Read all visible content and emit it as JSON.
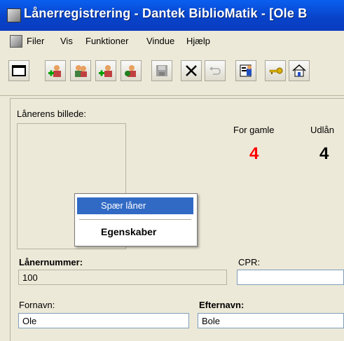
{
  "window": {
    "title": "Lånerregistrering - Dantek BiblioMatik - [Ole B"
  },
  "menu": [
    {
      "label": "Filer"
    },
    {
      "label": "Vis"
    },
    {
      "label": "Funktioner"
    },
    {
      "label": "Vindue"
    },
    {
      "label": "Hjælp"
    }
  ],
  "toolbar": {
    "buttons": [
      {
        "icon": "window-icon"
      },
      {
        "icon": "add-user-icon"
      },
      {
        "icon": "users-icon"
      },
      {
        "icon": "add-users-icon"
      },
      {
        "icon": "remove-user-icon"
      },
      {
        "icon": "save-icon"
      },
      {
        "icon": "delete-icon"
      },
      {
        "icon": "undo-icon"
      },
      {
        "icon": "properties-icon"
      },
      {
        "icon": "key-icon"
      },
      {
        "icon": "house-icon"
      }
    ]
  },
  "stats": {
    "photo_label": "Lånerens billede:",
    "for_gamle_label": "For gamle",
    "for_gamle_value": "4",
    "for_gamle_color": "#ff0000",
    "udlan_label": "Udlån",
    "udlan_value": "4"
  },
  "form": {
    "lanernummer_label": "Lånernummer:",
    "lanernummer_value": "100",
    "cpr_label": "CPR:",
    "cpr_value": "",
    "fornavn_label": "Fornavn:",
    "fornavn_value": "Ole",
    "efternavn_label": "Efternavn:",
    "efternavn_value": "Bole"
  },
  "context_menu": {
    "items": [
      {
        "label": "Spær låner",
        "highlighted": true
      },
      {
        "label": "Egenskaber",
        "bold": true
      }
    ]
  }
}
